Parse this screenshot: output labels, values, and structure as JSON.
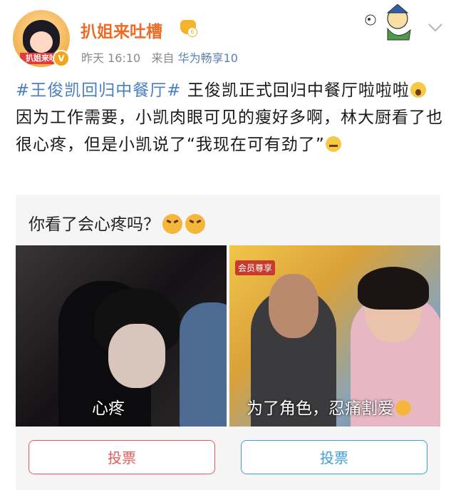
{
  "header": {
    "avatar_text": "扒姐来吐",
    "verified_mark": "V",
    "username": "扒姐来吐槽",
    "time": "昨天 16:10",
    "from_label": "来自",
    "device": "华为畅享10"
  },
  "post": {
    "topic": "#王俊凯回归中餐厅#",
    "text1": " 王俊凯正式回归中餐厅啦啦啦",
    "text2": "因为工作需要，小凯肉眼可见的瘦好多啊，林大厨看了也很心疼，但是小凯说了“我现在可有劲了”"
  },
  "poll": {
    "question": "你看了会心疼吗？",
    "left_caption": "心疼",
    "right_caption": "为了角色，忍痛割爱",
    "right_logo": "会员尊享",
    "left_vote": "投票",
    "right_vote": "投票"
  },
  "colors": {
    "accent": "#ef6b25",
    "topic": "#4a7fc3",
    "vote_left": "#e25a5a",
    "vote_right": "#3b9ed8"
  }
}
